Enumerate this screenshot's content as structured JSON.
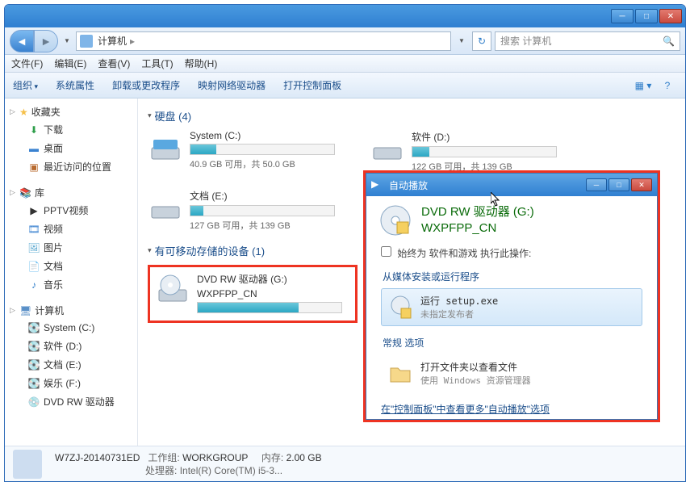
{
  "address": {
    "path": "计算机",
    "search_placeholder": "搜索 计算机"
  },
  "menu": {
    "file": "文件(F)",
    "edit": "编辑(E)",
    "view": "查看(V)",
    "tools": "工具(T)",
    "help": "帮助(H)"
  },
  "toolbar": {
    "organize": "组织",
    "props": "系统属性",
    "uninstall": "卸载或更改程序",
    "netdrive": "映射网络驱动器",
    "cpanel": "打开控制面板"
  },
  "sidebar": {
    "fav": {
      "title": "收藏夹",
      "items": [
        "下载",
        "桌面",
        "最近访问的位置"
      ]
    },
    "lib": {
      "title": "库",
      "items": [
        "PPTV视频",
        "视频",
        "图片",
        "文档",
        "音乐"
      ]
    },
    "comp": {
      "title": "计算机",
      "items": [
        "System (C:)",
        "软件 (D:)",
        "文档 (E:)",
        "娱乐 (F:)",
        "DVD RW 驱动器"
      ]
    }
  },
  "sections": {
    "hdd": "硬盘 (4)",
    "removable": "有可移动存储的设备 (1)"
  },
  "drives": {
    "c": {
      "name": "System (C:)",
      "stat": "40.9 GB 可用，共 50.0 GB",
      "fill": 18
    },
    "d": {
      "name": "软件 (D:)",
      "stat": "122 GB 可用，共 139 GB",
      "fill": 12
    },
    "e": {
      "name": "文档 (E:)",
      "stat": "127 GB 可用，共 139 GB",
      "fill": 9
    },
    "dvd": {
      "name": "DVD RW 驱动器 (G:)",
      "sub": "WXPFPP_CN",
      "fill": 70
    }
  },
  "status": {
    "name": "W7ZJ-20140731ED",
    "workgroup_label": "工作组:",
    "workgroup": "WORKGROUP",
    "mem_label": "内存:",
    "mem": "2.00 GB",
    "cpu_label": "处理器:",
    "cpu": "Intel(R) Core(TM) i5-3..."
  },
  "popup": {
    "title": "自动播放",
    "drive_line1": "DVD RW 驱动器 (G:)",
    "drive_line2": "WXPFPP_CN",
    "checkbox": "始终为 软件和游戏 执行此操作:",
    "sub1": "从媒体安装或运行程序",
    "opt1_l1": "运行 setup.exe",
    "opt1_l2": "未指定发布者",
    "sub2": "常规 选项",
    "opt2_l1": "打开文件夹以查看文件",
    "opt2_l2": "使用 Windows 资源管理器",
    "link": "在\"控制面板\"中查看更多\"自动播放\"选项"
  }
}
